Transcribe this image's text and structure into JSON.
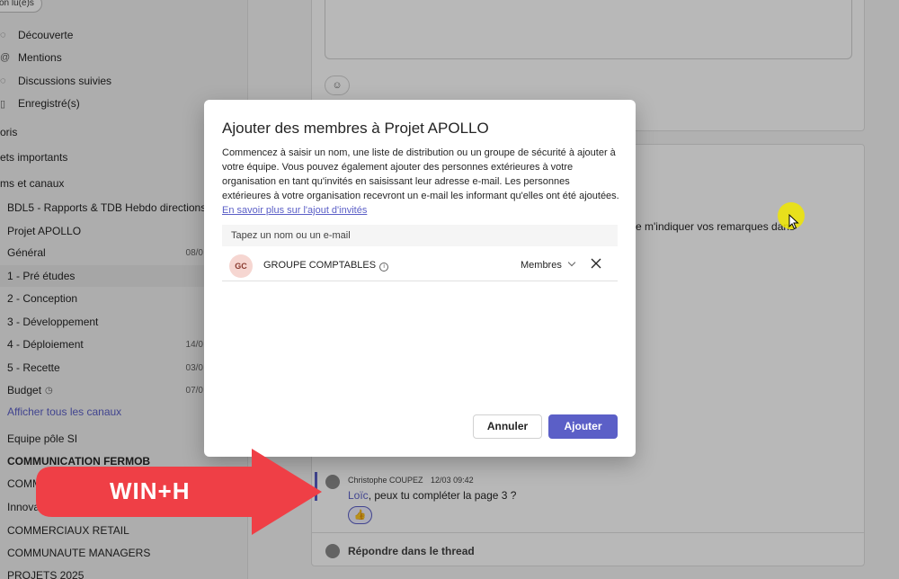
{
  "sidebar": {
    "unread_pill": "on lu(e)s",
    "nav": [
      {
        "icon": "◌",
        "label": "Découverte"
      },
      {
        "icon": "@",
        "label": "Mentions"
      },
      {
        "icon": "◌",
        "label": "Discussions suivies"
      },
      {
        "icon": "▯",
        "label": "Enregistré(s)"
      }
    ],
    "section_favoris": "oris",
    "section_importants": "ets importants",
    "section_teams": "ms et canaux",
    "team1": "BDL5 - Rapports & TDB Hebdo directions",
    "team2": "Projet APOLLO",
    "channels": [
      {
        "label": "Général",
        "date": "08/0"
      },
      {
        "label": "1 - Pré études",
        "date": ""
      },
      {
        "label": "2 - Conception",
        "date": ""
      },
      {
        "label": "3 - Développement",
        "date": ""
      },
      {
        "label": "4 - Déploiement",
        "date": "14/0"
      },
      {
        "label": "5 - Recette",
        "date": "03/0"
      },
      {
        "label": "Budget",
        "date": "07/0"
      }
    ],
    "show_all": "Afficher tous les canaux",
    "teams_more": [
      {
        "label": "Equipe pôle SI"
      },
      {
        "label": "COMMUNICATION FERMOB"
      },
      {
        "label": "COMM"
      },
      {
        "label": "Innovati"
      },
      {
        "label": "COMMERCIAUX RETAIL"
      },
      {
        "label": "COMMUNAUTE MANAGERS"
      },
      {
        "label": "PROJETS 2025"
      }
    ]
  },
  "main": {
    "bg_text": "e m'indiquer vos remarques dans",
    "message": {
      "author": "Christophe COUPEZ",
      "time": "12/03 09:42",
      "mention": "Loïc",
      "text": ", peux tu compléter la page 3 ?",
      "reaction": "👍"
    },
    "reply": "Répondre dans le thread"
  },
  "dialog": {
    "title": "Ajouter des membres à Projet APOLLO",
    "description": "Commencez à saisir un nom, une liste de distribution ou un groupe de sécurité à ajouter à votre équipe. Vous pouvez également ajouter des personnes extérieures à votre organisation en tant qu'invités en saisissant leur adresse e-mail. Les personnes extérieures à votre organisation recevront un e-mail les informant qu'elles ont été ajoutées.",
    "learn_more": "En savoir plus sur l'ajout d'invités",
    "search_placeholder": "Tapez un nom ou un e-mail",
    "member": {
      "initials": "GC",
      "name": "GROUPE COMPTABLES",
      "role": "Membres"
    },
    "cancel_label": "Annuler",
    "add_label": "Ajouter"
  },
  "annotation": {
    "shortcut": "WIN+H"
  },
  "colors": {
    "accent": "#5b5fc7",
    "arrow": "#ef3f46",
    "cursor_highlight": "#f0e600"
  }
}
